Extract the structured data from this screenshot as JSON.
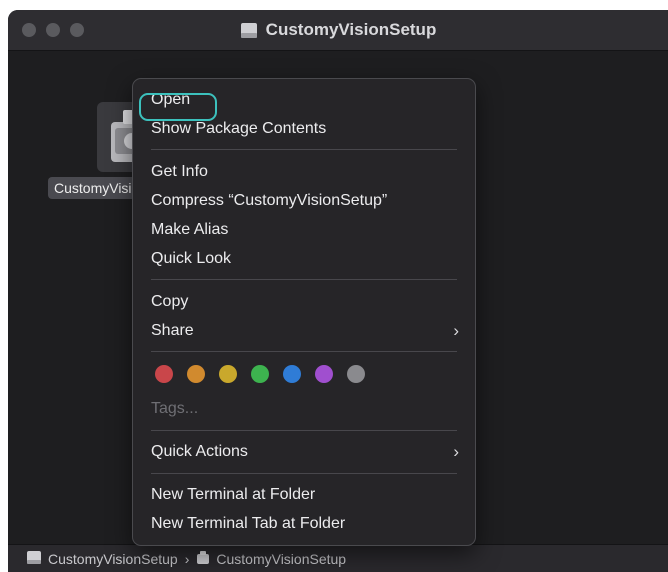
{
  "window": {
    "title": "CustomyVisionSetup"
  },
  "file": {
    "label": "CustomyVisionSetup",
    "icon": "installer-icon"
  },
  "context_menu": {
    "open": "Open",
    "show_package_contents": "Show Package Contents",
    "get_info": "Get Info",
    "compress": "Compress “CustomyVisionSetup”",
    "make_alias": "Make Alias",
    "quick_look": "Quick Look",
    "copy": "Copy",
    "share": "Share",
    "tags_placeholder": "Tags...",
    "quick_actions": "Quick Actions",
    "new_terminal_at_folder": "New Terminal at Folder",
    "new_terminal_tab_at_folder": "New Terminal Tab at Folder",
    "submenu_chevron": "›",
    "tag_colors": [
      {
        "name": "red",
        "color": "#c9464a"
      },
      {
        "name": "orange",
        "color": "#d18a2e"
      },
      {
        "name": "yellow",
        "color": "#c9a82c"
      },
      {
        "name": "green",
        "color": "#3db34f"
      },
      {
        "name": "blue",
        "color": "#2f7cd6"
      },
      {
        "name": "purple",
        "color": "#a04fcf"
      },
      {
        "name": "gray",
        "color": "#8a8a8e"
      }
    ],
    "highlight_color": "#3cc1bd"
  },
  "path_bar": {
    "segments": [
      "CustomyVisionSetup",
      "CustomyVisionSetup"
    ],
    "separator": "›"
  }
}
